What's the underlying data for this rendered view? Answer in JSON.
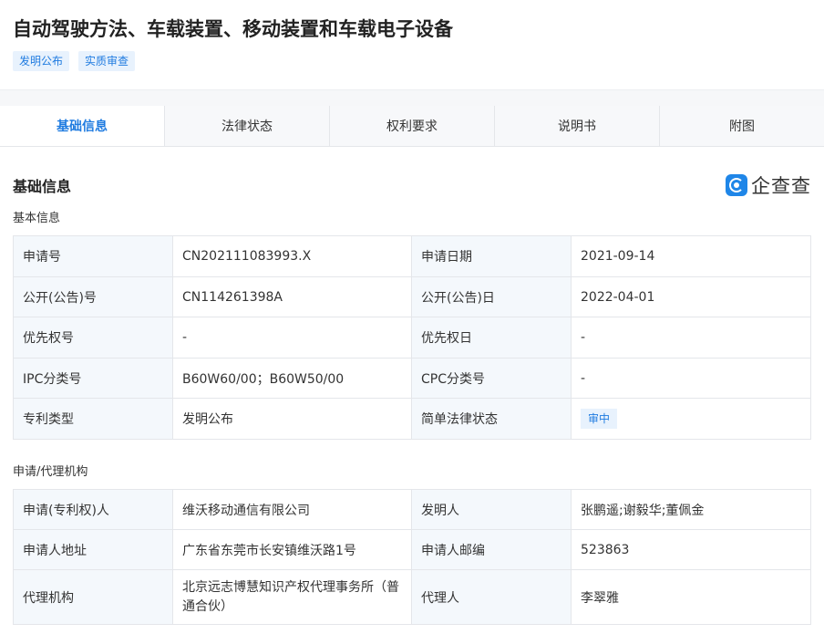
{
  "header": {
    "title": "自动驾驶方法、车载装置、移动装置和车载电子设备",
    "tags": [
      "发明公布",
      "实质审查"
    ]
  },
  "tabs": [
    {
      "label": "基础信息",
      "active": true
    },
    {
      "label": "法律状态",
      "active": false
    },
    {
      "label": "权利要求",
      "active": false
    },
    {
      "label": "说明书",
      "active": false
    },
    {
      "label": "附图",
      "active": false
    }
  ],
  "section": {
    "title": "基础信息",
    "logo_text": "企查查"
  },
  "basic": {
    "title": "基本信息",
    "rows": [
      {
        "l1": "申请号",
        "v1": "CN202111083993.X",
        "l2": "申请日期",
        "v2": "2021-09-14"
      },
      {
        "l1": "公开(公告)号",
        "v1": "CN114261398A",
        "l2": "公开(公告)日",
        "v2": "2022-04-01"
      },
      {
        "l1": "优先权号",
        "v1": "-",
        "l2": "优先权日",
        "v2": "-"
      },
      {
        "l1": "IPC分类号",
        "v1": "B60W60/00；B60W50/00",
        "l2": "CPC分类号",
        "v2": "-"
      },
      {
        "l1": "专利类型",
        "v1": "发明公布",
        "l2": "简单法律状态",
        "v2": "审中"
      }
    ]
  },
  "agency": {
    "title": "申请/代理机构",
    "rows": [
      {
        "l1": "申请(专利权)人",
        "v1": "维沃移动通信有限公司",
        "l2": "发明人",
        "v2": "张鹏遥;谢毅华;董佩金"
      },
      {
        "l1": "申请人地址",
        "v1": "广东省东莞市长安镇维沃路1号",
        "l2": "申请人邮编",
        "v2": "523863"
      },
      {
        "l1": "代理机构",
        "v1": "北京远志博慧知识产权代理事务所（普通合伙）",
        "l2": "代理人",
        "v2": "李翠雅"
      }
    ]
  }
}
